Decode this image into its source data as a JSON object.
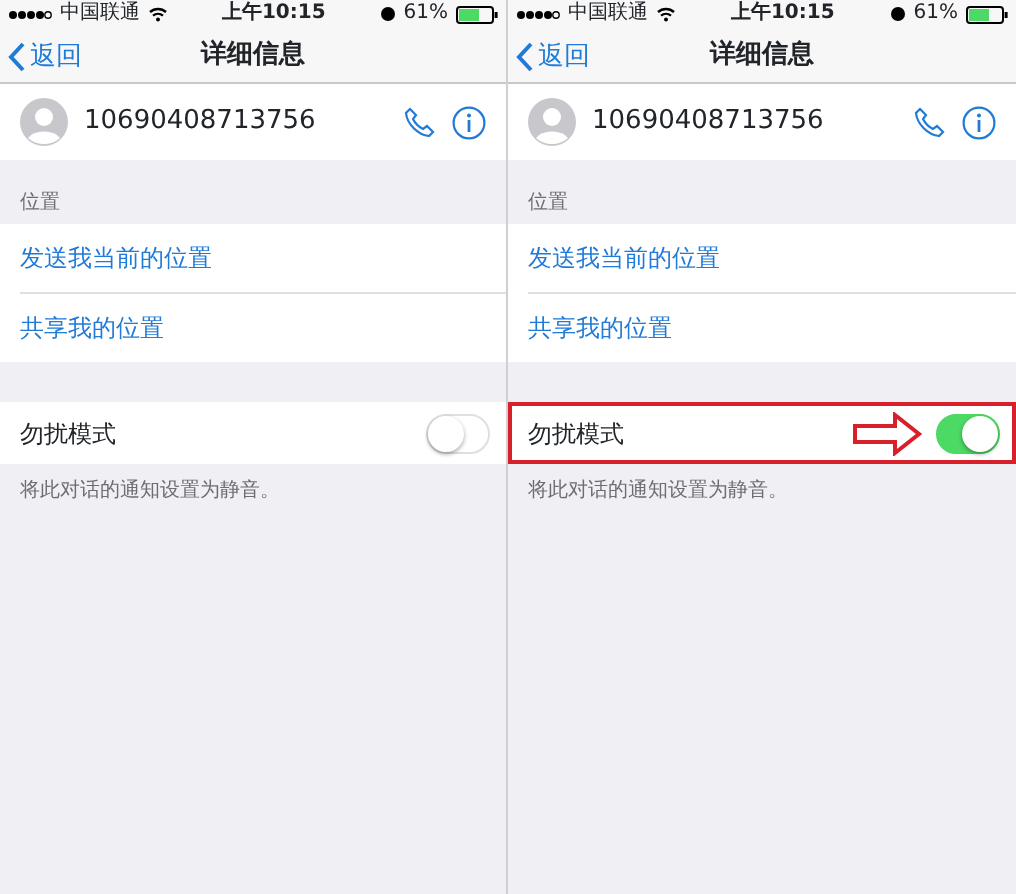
{
  "screens": [
    {
      "status_bar": {
        "carrier": "中国联通",
        "time": "上午10:15",
        "battery": "61%"
      },
      "nav": {
        "back": "返回",
        "title": "详细信息"
      },
      "contact": {
        "number": "10690408713756"
      },
      "section_header": "位置",
      "location_actions": [
        "发送我当前的位置",
        "共享我的位置"
      ],
      "dnd": {
        "label": "勿扰模式",
        "on": false,
        "highlighted": false
      },
      "footnote": "将此对话的通知设置为静音。"
    },
    {
      "status_bar": {
        "carrier": "中国联通",
        "time": "上午10:15",
        "battery": "61%"
      },
      "nav": {
        "back": "返回",
        "title": "详细信息"
      },
      "contact": {
        "number": "10690408713756"
      },
      "section_header": "位置",
      "location_actions": [
        "发送我当前的位置",
        "共享我的位置"
      ],
      "dnd": {
        "label": "勿扰模式",
        "on": true,
        "highlighted": true
      },
      "footnote": "将此对话的通知设置为静音。"
    }
  ]
}
